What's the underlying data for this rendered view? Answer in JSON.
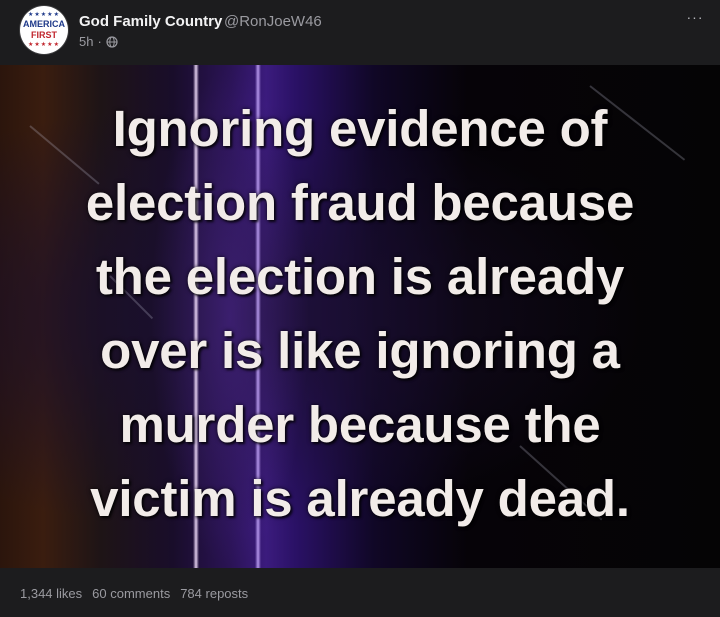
{
  "post": {
    "author": {
      "display_name": "God Family Country",
      "handle": "@RonJoeW46",
      "avatar": {
        "line1": "AMERICA",
        "line2": "FIRST",
        "stars": "★★★★★"
      }
    },
    "time": "5h",
    "separator": "·",
    "visibility_icon": "globe-icon",
    "more_icon": "more-horizontal-icon",
    "more_label": "···",
    "image_text": [
      "Ignoring evidence of",
      "election fraud because",
      "the election is already",
      "over is like ignoring a",
      "murder because the",
      "victim is already dead."
    ],
    "stats": {
      "likes": "1,344 likes",
      "comments": "60 comments",
      "reposts": "784 reposts"
    }
  },
  "colors": {
    "background": "#1c1c1e",
    "text_primary": "#f2f2f3",
    "text_secondary": "#9a9aa0",
    "accent_purple": "#3b1b7d"
  }
}
